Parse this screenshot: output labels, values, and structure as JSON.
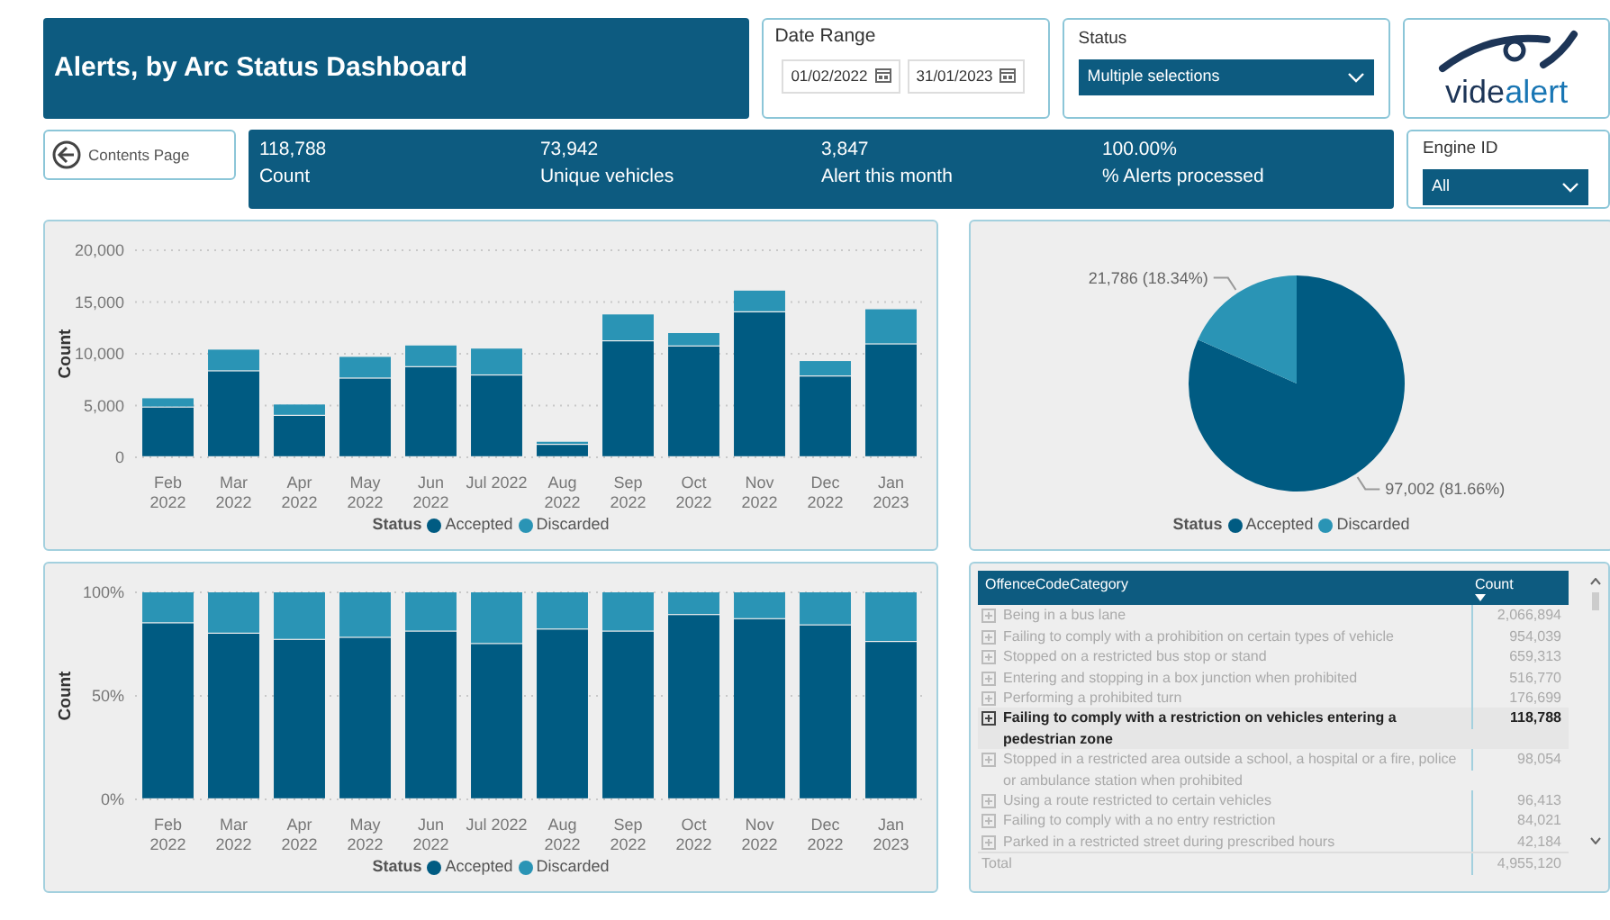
{
  "header": {
    "title": "Alerts, by Arc Status Dashboard"
  },
  "date_range": {
    "label": "Date Range",
    "start": "01/02/2022",
    "end": "31/01/2023"
  },
  "status_filter": {
    "label": "Status",
    "value": "Multiple selections"
  },
  "logo": {
    "text_1": "vide",
    "text_2": "alert"
  },
  "contents_button": {
    "label": "Contents Page"
  },
  "kpis": [
    {
      "value": "118,788",
      "label": "Count"
    },
    {
      "value": "73,942",
      "label": "Unique vehicles"
    },
    {
      "value": "3,847",
      "label": "Alert this month"
    },
    {
      "value": "100.00%",
      "label": "% Alerts processed"
    }
  ],
  "engine_filter": {
    "label": "Engine ID",
    "value": "All"
  },
  "bar_chart": {
    "chart_data": {
      "type": "bar",
      "stacked": true,
      "grid": true,
      "legend": {
        "title": "Status"
      },
      "ylabel": "Count",
      "categories": [
        "Feb\n2022",
        "Mar\n2022",
        "Apr\n2022",
        "May\n2022",
        "Jun\n2022",
        "Jul 2022",
        "Aug\n2022",
        "Sep\n2022",
        "Oct\n2022",
        "Nov\n2022",
        "Dec\n2022",
        "Jan\n2023"
      ],
      "ylim": [
        0,
        20000
      ],
      "yticks": [
        {
          "value": 0,
          "label": "0"
        },
        {
          "value": 5000,
          "label": "5,000"
        },
        {
          "value": 10000,
          "label": "10,000"
        },
        {
          "value": 15000,
          "label": "15,000"
        },
        {
          "value": 20000,
          "label": "20,000"
        }
      ],
      "series": [
        {
          "name": "Accepted",
          "color": "#005b82",
          "values": [
            4800,
            8300,
            4000,
            7600,
            8700,
            7900,
            1200,
            11200,
            10700,
            14000,
            7800,
            10900
          ]
        },
        {
          "name": "Discarded",
          "color": "#2a94b5",
          "values": [
            900,
            2100,
            1100,
            2100,
            2100,
            2600,
            300,
            2600,
            1300,
            2100,
            1500,
            3400
          ]
        }
      ]
    }
  },
  "pie_chart": {
    "chart_data": {
      "type": "pie",
      "legend": {
        "title": "Status"
      },
      "categories": [
        "Accepted",
        "Discarded"
      ],
      "values": [
        97002,
        21786
      ],
      "colors": [
        "#005b82",
        "#2a94b5"
      ],
      "value_labels": [
        "97,002 (81.66%)",
        "21,786 (18.34%)"
      ]
    }
  },
  "percent_chart": {
    "chart_data": {
      "type": "bar",
      "stacked": true,
      "grid": true,
      "legend": {
        "title": "Status"
      },
      "ylabel": "Count",
      "categories": [
        "Feb\n2022",
        "Mar\n2022",
        "Apr\n2022",
        "May\n2022",
        "Jun\n2022",
        "Jul 2022",
        "Aug\n2022",
        "Sep\n2022",
        "Oct\n2022",
        "Nov\n2022",
        "Dec\n2022",
        "Jan\n2023"
      ],
      "ylim": [
        0,
        100
      ],
      "yticks": [
        {
          "value": 0,
          "label": "0%"
        },
        {
          "value": 50,
          "label": "50%"
        },
        {
          "value": 100,
          "label": "100%"
        }
      ],
      "series": [
        {
          "name": "Accepted",
          "color": "#005b82",
          "values": [
            85,
            80,
            77,
            78,
            81,
            75,
            82,
            81,
            89,
            87,
            84,
            76
          ]
        },
        {
          "name": "Discarded",
          "color": "#2a94b5",
          "values": [
            15,
            20,
            23,
            22,
            19,
            25,
            18,
            19,
            11,
            13,
            16,
            24
          ]
        }
      ]
    }
  },
  "table": {
    "columns": [
      "OffenceCodeCategory",
      "Count"
    ],
    "rows": [
      {
        "category": "Being in a bus lane",
        "count": "2,066,894",
        "selected": false
      },
      {
        "category": "Failing to comply with a prohibition on certain types of vehicle",
        "count": "954,039",
        "selected": false
      },
      {
        "category": "Stopped on a restricted bus stop or stand",
        "count": "659,313",
        "selected": false
      },
      {
        "category": "Entering and stopping in a box junction when prohibited",
        "count": "516,770",
        "selected": false
      },
      {
        "category": "Performing a prohibited turn",
        "count": "176,699",
        "selected": false
      },
      {
        "category": "Failing to comply with a restriction on vehicles entering a pedestrian zone",
        "count": "118,788",
        "selected": true
      },
      {
        "category": "Stopped in a restricted area outside a school, a hospital or a fire, police or ambulance station when prohibited",
        "count": "98,054",
        "selected": false
      },
      {
        "category": "Using a route restricted to certain vehicles",
        "count": "96,413",
        "selected": false
      },
      {
        "category": "Failing to comply with a no entry restriction",
        "count": "84,021",
        "selected": false
      },
      {
        "category": "Parked in a restricted street during prescribed hours",
        "count": "42,184",
        "selected": false
      }
    ],
    "total": {
      "label": "Total",
      "count": "4,955,120"
    }
  }
}
